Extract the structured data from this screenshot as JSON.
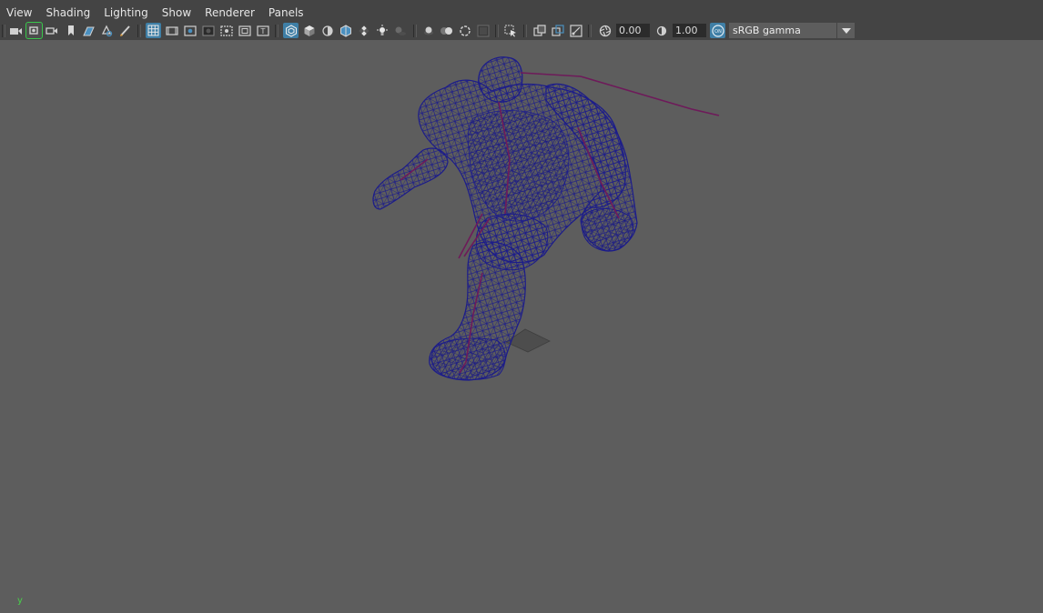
{
  "menu": {
    "items": [
      {
        "label": "View"
      },
      {
        "label": "Shading"
      },
      {
        "label": "Lighting"
      },
      {
        "label": "Show"
      },
      {
        "label": "Renderer"
      },
      {
        "label": "Panels"
      }
    ]
  },
  "toolbar": {
    "exposure_value": "0.00",
    "gamma_value": "1.00",
    "color_management_badge": "ON",
    "colorspace_value": "sRGB gamma",
    "accent_color": "#3f7fa6",
    "active_outline_color": "#38c84a"
  },
  "viewport": {
    "axis_label": "y",
    "background_color": "#5d5d5d",
    "wireframe_color": "#1c1c8a",
    "joint_color": "#7a1a5a"
  }
}
